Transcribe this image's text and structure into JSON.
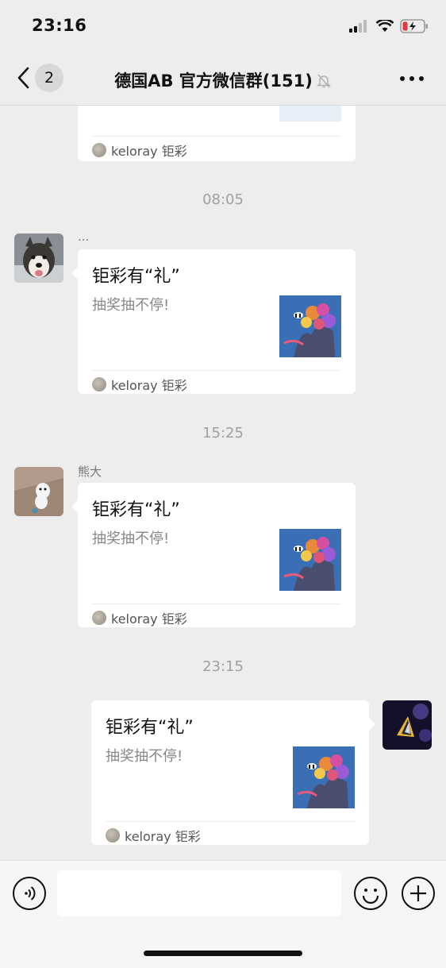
{
  "status": {
    "time": "23:16"
  },
  "nav": {
    "back_count": "2",
    "title": "德国AB  官方微信群(151)"
  },
  "messages": [
    {
      "source": "keloray 钜彩"
    },
    {
      "time": "08:05",
      "sender": "...",
      "title": "钜彩有“礼”",
      "desc": "抽奖抽不停!",
      "source": "keloray 钜彩"
    },
    {
      "time": "15:25",
      "sender": "熊大",
      "title": "钜彩有“礼”",
      "desc": "抽奖抽不停!",
      "source": "keloray 钜彩"
    },
    {
      "time": "23:15",
      "title": "钜彩有“礼”",
      "desc": "抽奖抽不停!",
      "source": "keloray 钜彩"
    }
  ],
  "input": {
    "placeholder": ""
  },
  "colors": {
    "background": "#ededed",
    "card": "#ffffff",
    "thumb": "#3a6eb5"
  }
}
